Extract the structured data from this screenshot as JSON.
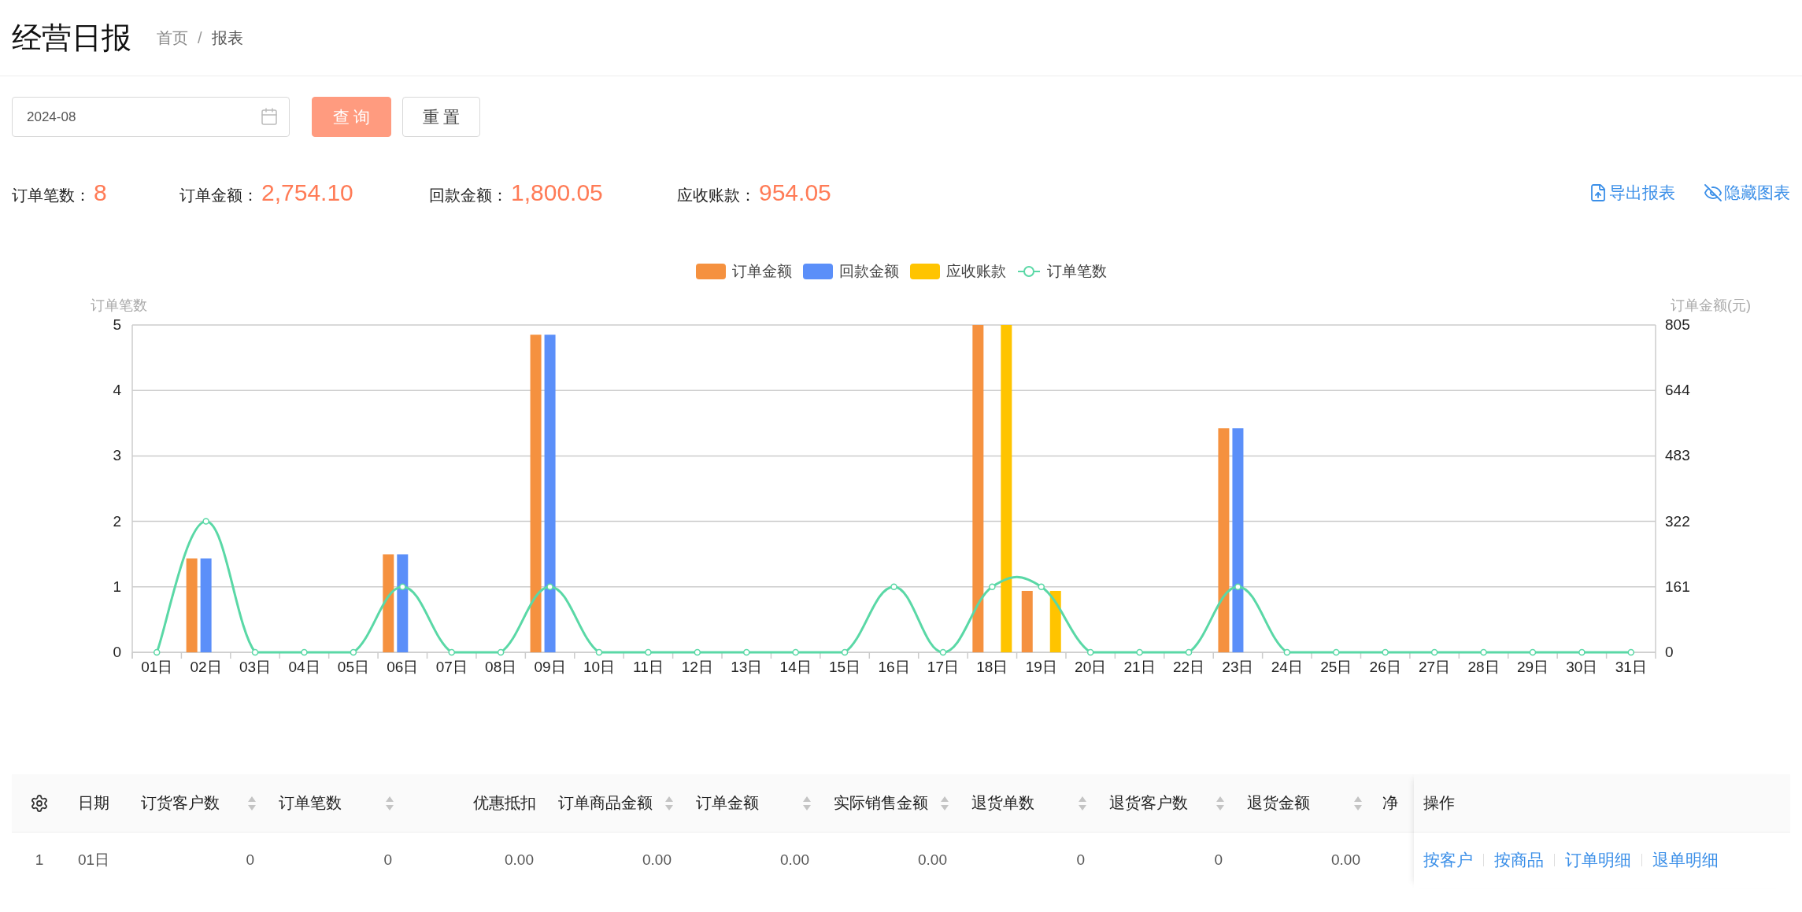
{
  "page": {
    "title": "经营日报",
    "breadcrumb_separator": "/",
    "breadcrumb": [
      {
        "label": "首页",
        "selected": false
      },
      {
        "label": "报表",
        "selected": true
      }
    ]
  },
  "filters": {
    "month": {
      "value": "2024-08"
    },
    "buttons": [
      {
        "label": "查 询",
        "kind": "primary"
      },
      {
        "label": "重 置",
        "kind": "default"
      }
    ]
  },
  "summary": [
    {
      "label": "订单笔数：",
      "value": "8"
    },
    {
      "label": "订单金额：",
      "value": "2,754.10"
    },
    {
      "label": "回款金额：",
      "value": "1,800.05"
    },
    {
      "label": "应收账款：",
      "value": "954.05"
    }
  ],
  "actions": [
    {
      "label": "导出报表",
      "kind": "export"
    },
    {
      "label": "隐藏图表",
      "kind": "hide"
    }
  ],
  "chart": {
    "chart_data": {
      "type": "bar",
      "grid": true,
      "ylabel": "订单笔数",
      "y2label": "订单金额(元)",
      "categories": [
        "01日",
        "02日",
        "03日",
        "04日",
        "05日",
        "06日",
        "07日",
        "08日",
        "09日",
        "10日",
        "11日",
        "12日",
        "13日",
        "14日",
        "15日",
        "16日",
        "17日",
        "18日",
        "19日",
        "20日",
        "21日",
        "22日",
        "23日",
        "24日",
        "25日",
        "26日",
        "27日",
        "28日",
        "29日",
        "30日",
        "31日"
      ],
      "ylim": [
        0,
        5
      ],
      "yticks": [
        0,
        1,
        2,
        3,
        4,
        5
      ],
      "y2lim": [
        0,
        805
      ],
      "y2ticks": [
        0,
        161,
        322,
        483,
        644,
        805
      ],
      "series": [
        {
          "name": "订单金额",
          "type": "bar",
          "axis": "y2",
          "color": "#f5913f",
          "values": [
            0,
            231,
            0,
            0,
            0,
            241,
            0,
            0,
            781,
            0,
            0,
            0,
            0,
            0,
            0,
            0,
            0,
            805,
            151,
            0,
            0,
            0,
            551,
            0,
            0,
            0,
            0,
            0,
            0,
            0,
            0
          ]
        },
        {
          "name": "回款金额",
          "type": "bar",
          "axis": "y2",
          "color": "#5b8ff9",
          "values": [
            0,
            231,
            0,
            0,
            0,
            241,
            0,
            0,
            781,
            0,
            0,
            0,
            0,
            0,
            0,
            0,
            0,
            0,
            0,
            0,
            0,
            0,
            551,
            0,
            0,
            0,
            0,
            0,
            0,
            0,
            0
          ]
        },
        {
          "name": "应收账款",
          "type": "bar",
          "axis": "y2",
          "color": "#ffc400",
          "values": [
            0,
            0,
            0,
            0,
            0,
            0,
            0,
            0,
            0,
            0,
            0,
            0,
            0,
            0,
            0,
            0,
            0,
            805,
            151,
            0,
            0,
            0,
            0,
            0,
            0,
            0,
            0,
            0,
            0,
            0,
            0
          ]
        },
        {
          "name": "订单笔数",
          "type": "line",
          "marker": true,
          "color": "#5ad8a6",
          "values": [
            0,
            2,
            0,
            0,
            0,
            1,
            0,
            0,
            1,
            0,
            0,
            0,
            0,
            0,
            0,
            1,
            0,
            1,
            1,
            0,
            0,
            0,
            1,
            0,
            0,
            0,
            0,
            0,
            0,
            0,
            0
          ]
        }
      ]
    }
  },
  "table": {
    "columns": [
      {
        "label": "日期",
        "sortable": false
      },
      {
        "label": "订货客户数",
        "sortable": true
      },
      {
        "label": "订单笔数",
        "sortable": true
      },
      {
        "label": "优惠抵扣",
        "sortable": false
      },
      {
        "label": "订单商品金额",
        "sortable": true
      },
      {
        "label": "订单金额",
        "sortable": true
      },
      {
        "label": "实际销售金额",
        "sortable": true
      },
      {
        "label": "退货单数",
        "sortable": true
      },
      {
        "label": "退货客户数",
        "sortable": true
      },
      {
        "label": "退货金额",
        "sortable": true
      },
      {
        "label": "净",
        "sortable": false
      }
    ],
    "action_column": "操作",
    "rows": [
      {
        "index": "1",
        "cells": [
          "01日",
          "0",
          "0",
          "0.00",
          "0.00",
          "0.00",
          "0.00",
          "0",
          "0",
          "0.00"
        ],
        "links": [
          "按客户",
          "按商品",
          "订单明细",
          "退单明细"
        ]
      }
    ]
  }
}
